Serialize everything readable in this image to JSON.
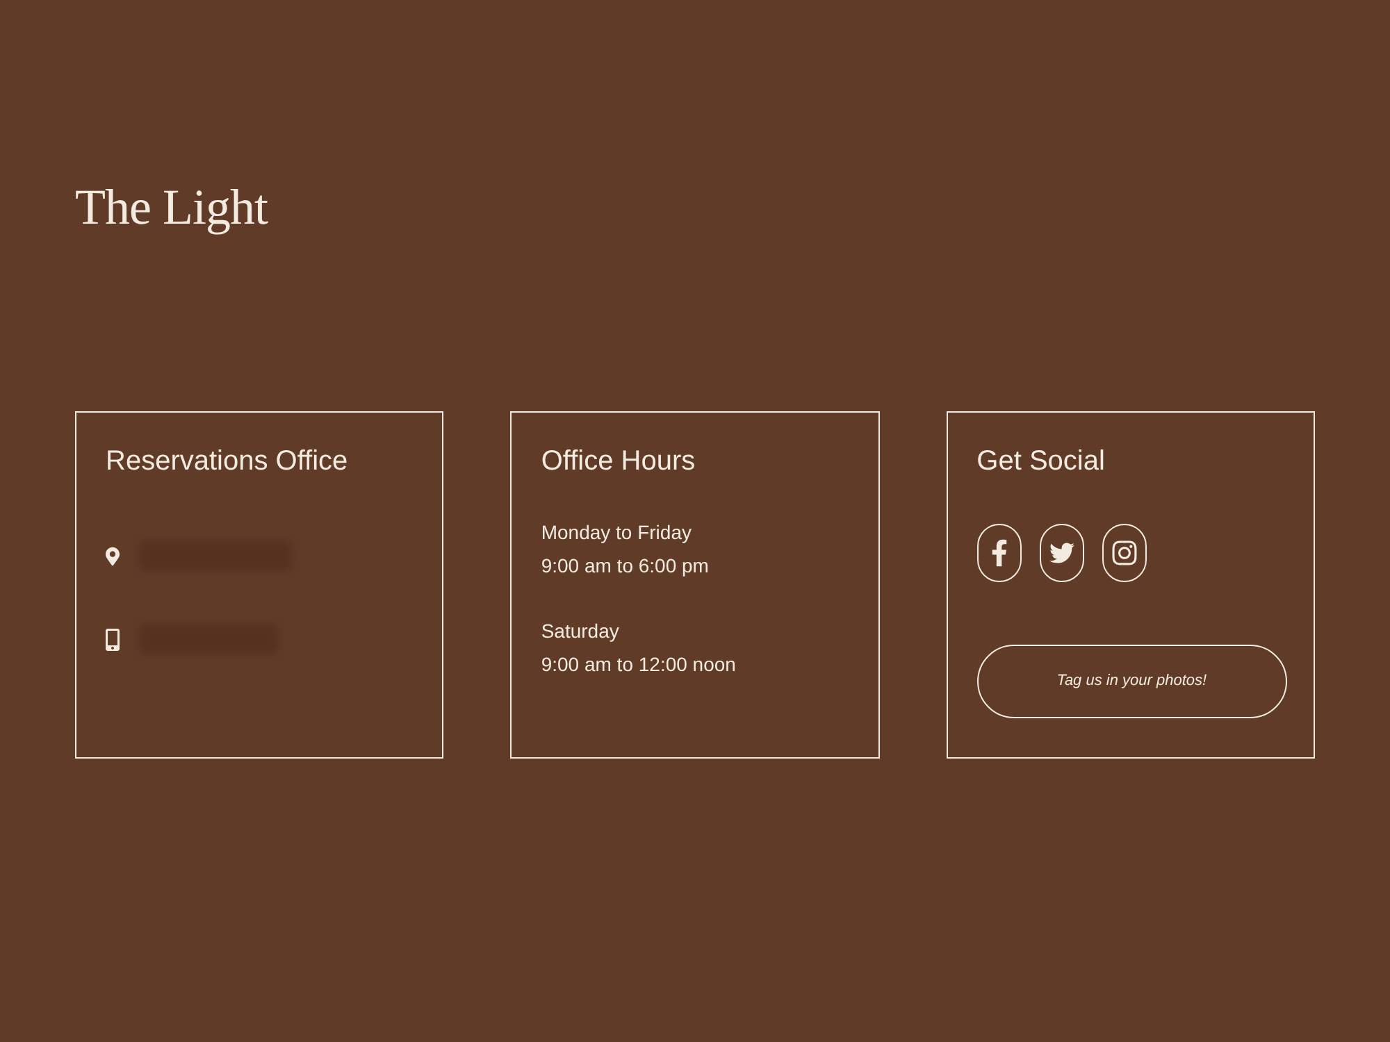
{
  "header": {
    "title": "The Light"
  },
  "cards": [
    {
      "kind": "contact",
      "title": "Reservations Office",
      "contacts": [
        {
          "kind": "location"
        },
        {
          "kind": "phone"
        }
      ]
    },
    {
      "kind": "hours",
      "title": "Office Hours",
      "groups": [
        {
          "days": "Monday to Friday",
          "hours": "9:00 am to 6:00 pm"
        },
        {
          "days": "Saturday",
          "hours": "9:00 am to 12:00 noon"
        }
      ]
    },
    {
      "kind": "social",
      "title": "Get Social",
      "links": [
        {
          "kind": "facebook"
        },
        {
          "kind": "twitter"
        },
        {
          "kind": "instagram"
        }
      ],
      "button": "Tag us in your photos!"
    }
  ]
}
